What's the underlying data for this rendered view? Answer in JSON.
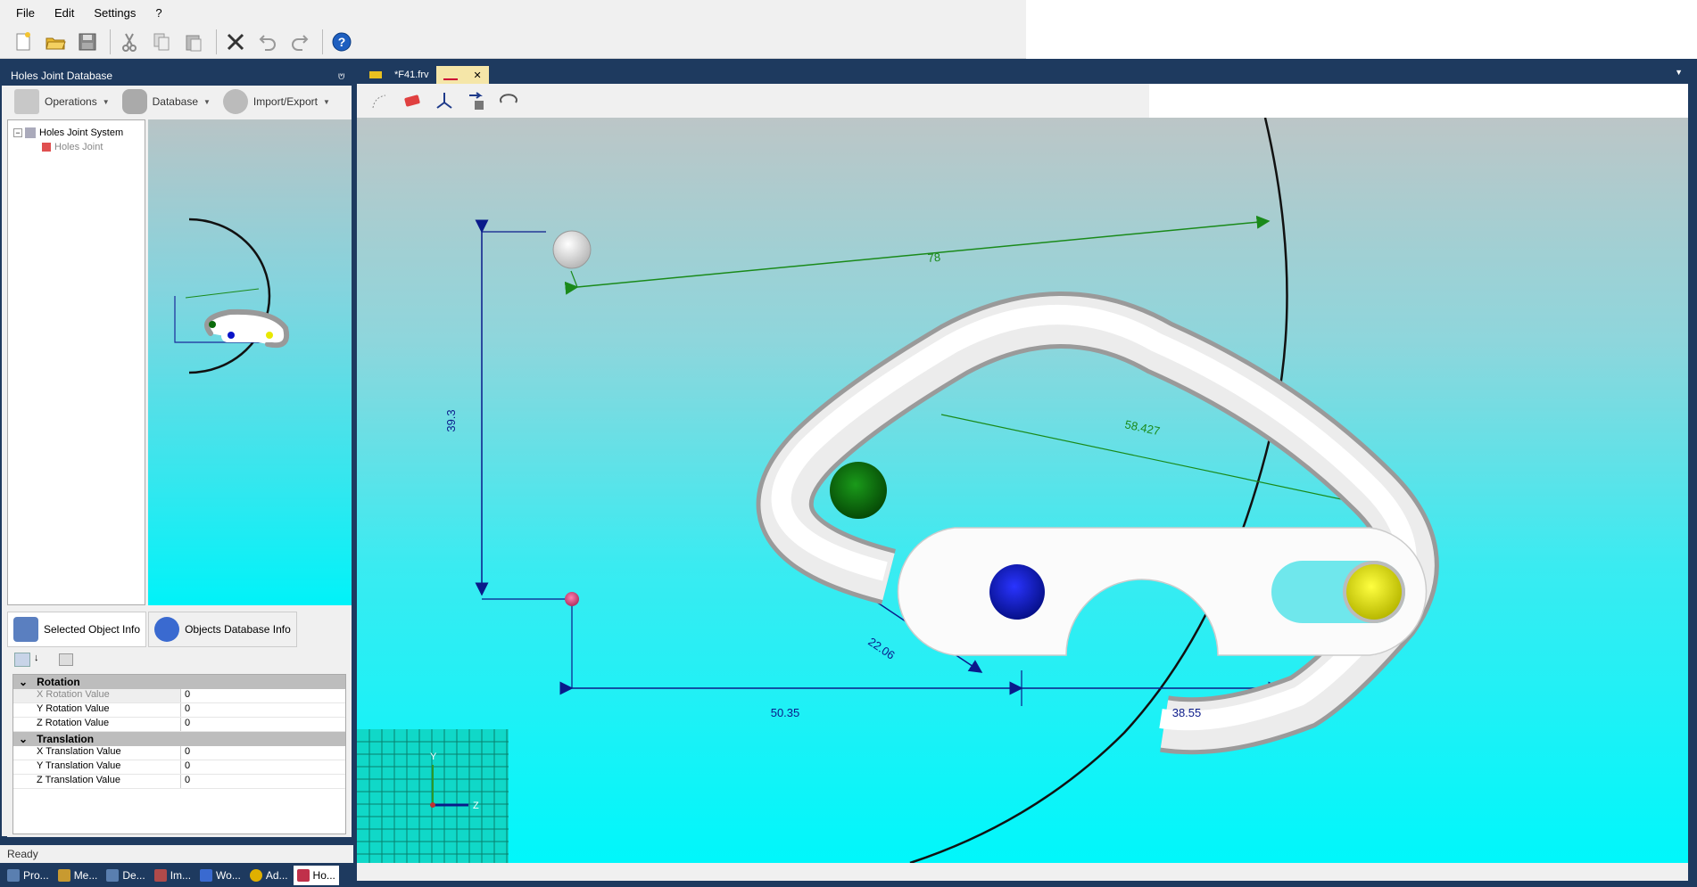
{
  "menu": [
    "File",
    "Edit",
    "Settings",
    "?"
  ],
  "toolbar_icons": [
    "new-icon",
    "open-icon",
    "save-icon",
    "cut-icon",
    "copy-icon",
    "paste-icon",
    "delete-icon",
    "undo-icon",
    "redo-icon",
    "help-icon"
  ],
  "left_panel": {
    "title": "Holes Joint Database",
    "pin": "⩅",
    "toolbar": {
      "operations": "Operations",
      "database": "Database",
      "import_export": "Import/Export"
    },
    "tree": {
      "root": "Holes Joint System",
      "child": "Holes Joint"
    }
  },
  "props": {
    "tab_selected": "Selected Object Info",
    "tab_db": "Objects Database Info",
    "rotation": {
      "title": "Rotation",
      "rows": [
        {
          "key": "X Rotation Value",
          "value": "0"
        },
        {
          "key": "Y Rotation Value",
          "value": "0"
        },
        {
          "key": "Z Rotation Value",
          "value": "0"
        }
      ]
    },
    "translation": {
      "title": "Translation",
      "rows": [
        {
          "key": "X Translation Value",
          "value": "0"
        },
        {
          "key": "Y Translation Value",
          "value": "0"
        },
        {
          "key": "Z Translation Value",
          "value": "0"
        }
      ]
    }
  },
  "status": "Ready",
  "bottom_tabs": [
    {
      "label": "Pro...",
      "color": "#5a7fb0"
    },
    {
      "label": "Me...",
      "color": "#c89a30"
    },
    {
      "label": "De...",
      "color": "#5a7fb0"
    },
    {
      "label": "Im...",
      "color": "#b04a4a"
    },
    {
      "label": "Wo...",
      "color": "#3a6ad0"
    },
    {
      "label": "Ad...",
      "color": "#e0b000"
    },
    {
      "label": "Ho...",
      "color": "#c0304a"
    }
  ],
  "doc_tabs": {
    "file": "*F41.frv",
    "close": "✕",
    "dropdown": "▼"
  },
  "viewport_icons": [
    "select-icon",
    "tag-icon",
    "axes-icon",
    "import-icon",
    "rotate-icon"
  ],
  "dimensions": {
    "d78": "78",
    "d393": "39.3",
    "d58": "58.427",
    "d2206": "22.06",
    "d5035": "50.35",
    "d3855": "38.55"
  },
  "axis": {
    "y": "Y",
    "z": "Z"
  },
  "colors": {
    "dim_blue": "#0a1a8a",
    "dim_green": "#1a8a1a",
    "ball_green": "#0a6a0a",
    "ball_blue": "#0a14c8",
    "ball_yellow": "#e8e800"
  }
}
